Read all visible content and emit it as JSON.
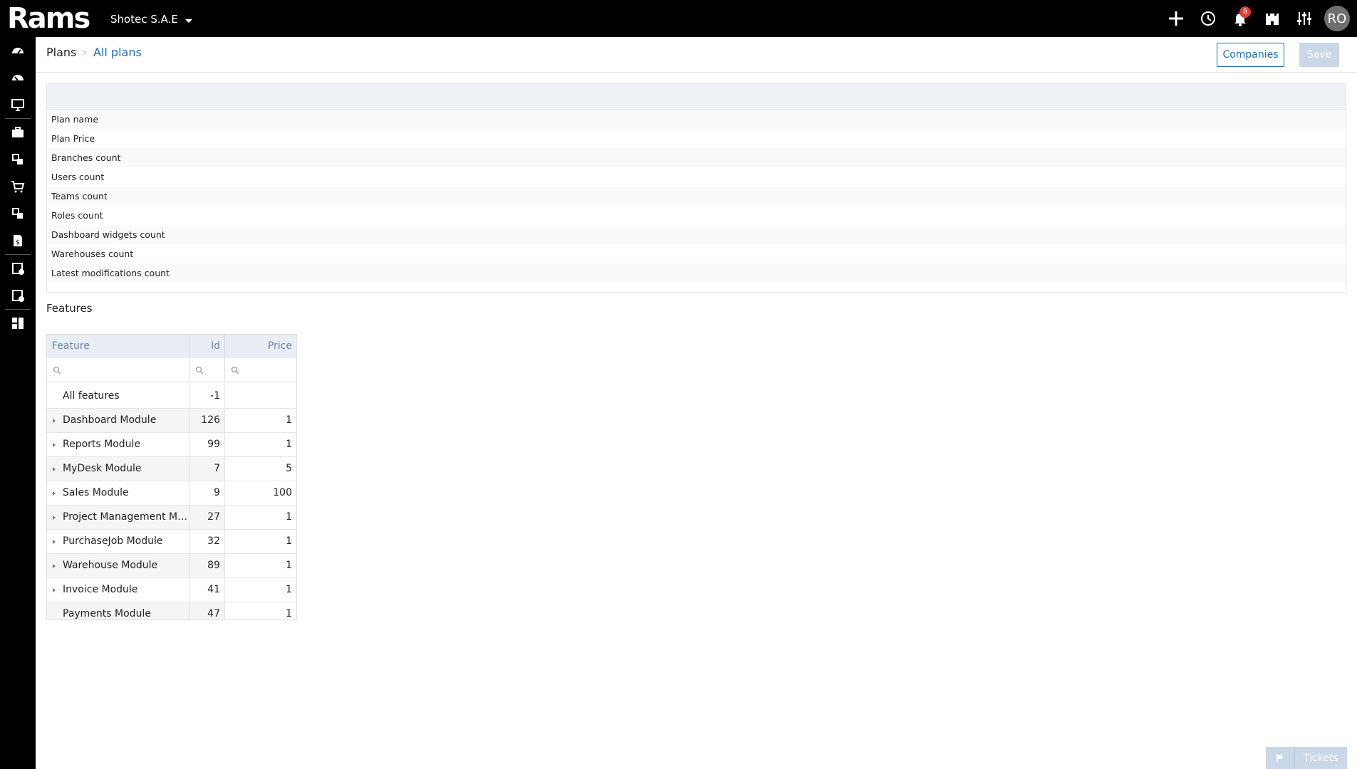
{
  "app": {
    "logo_text": "Rams",
    "company": "Shotec S.A.E",
    "notifications_count": "8",
    "user_initials": "RO"
  },
  "breadcrumb": {
    "root": "Plans",
    "current": "All plans"
  },
  "actions": {
    "companies_label": "Companies",
    "save_label": "Save"
  },
  "form": {
    "rows": [
      "Plan name",
      "Plan Price",
      "Branches count",
      "Users count",
      "Teams count",
      "Roles count",
      "Dashboard widgets count",
      "Warehouses count",
      "Latest modifications count"
    ]
  },
  "features": {
    "title": "Features",
    "columns": {
      "feature": "Feature",
      "id": "Id",
      "price": "Price"
    },
    "rows": [
      {
        "name": "All features",
        "id": "-1",
        "price": "",
        "expandable": false
      },
      {
        "name": "Dashboard Module",
        "id": "126",
        "price": "1",
        "expandable": true
      },
      {
        "name": "Reports Module",
        "id": "99",
        "price": "1",
        "expandable": true
      },
      {
        "name": "MyDesk Module",
        "id": "7",
        "price": "5",
        "expandable": true
      },
      {
        "name": "Sales Module",
        "id": "9",
        "price": "100",
        "expandable": true
      },
      {
        "name": "Project Management Module",
        "id": "27",
        "price": "1",
        "expandable": true
      },
      {
        "name": "PurchaseJob Module",
        "id": "32",
        "price": "1",
        "expandable": true
      },
      {
        "name": "Warehouse Module",
        "id": "89",
        "price": "1",
        "expandable": true
      },
      {
        "name": "Invoice Module",
        "id": "41",
        "price": "1",
        "expandable": true
      },
      {
        "name": "Payments Module",
        "id": "47",
        "price": "1",
        "expandable": false
      }
    ]
  },
  "tickets": {
    "label": "Tickets"
  }
}
